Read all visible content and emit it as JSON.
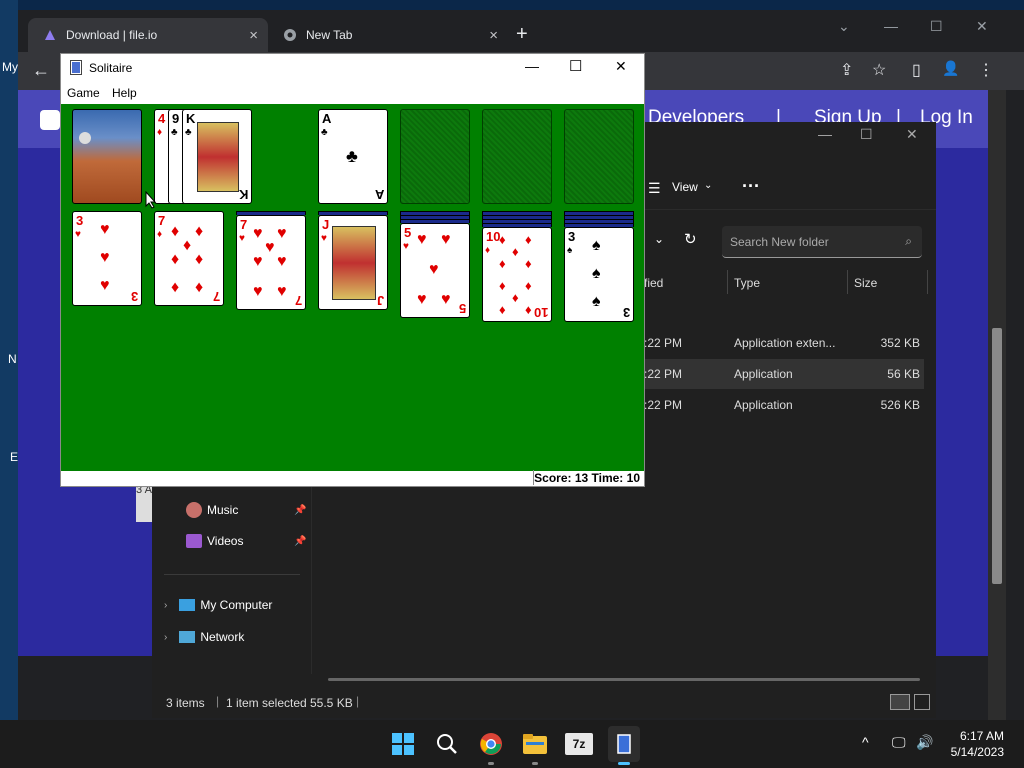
{
  "desktop": {
    "labels": [
      "My",
      "N",
      "E"
    ]
  },
  "browser": {
    "tabs": [
      {
        "title": "Download | file.io",
        "close": "×"
      },
      {
        "title": "New Tab",
        "close": "×"
      }
    ],
    "new_tab": "+",
    "window_controls": {
      "list": "⌄",
      "min": "—",
      "max": "☐",
      "close": "✕"
    },
    "toolbar": {
      "back": "←",
      "share": "⇪",
      "star": "☆",
      "sidebar": "▯",
      "profile": "👤",
      "menu": "⋮"
    },
    "page": {
      "nav": [
        "Developers",
        "|",
        "Sign Up",
        "|",
        "Log In"
      ],
      "left_text": "3 A"
    }
  },
  "explorer": {
    "window_controls": {
      "min": "—",
      "max": "☐",
      "close": "✕"
    },
    "view_label": "View",
    "more": "···",
    "search_placeholder": "Search New folder",
    "columns": [
      "fied",
      "Type",
      "Size"
    ],
    "rows": [
      {
        "date": ":22 PM",
        "type": "Application exten...",
        "size": "352 KB",
        "selected": false
      },
      {
        "date": ":22 PM",
        "type": "Application",
        "size": "56 KB",
        "selected": true
      },
      {
        "date": ":22 PM",
        "type": "Application",
        "size": "526 KB",
        "selected": false
      }
    ],
    "nav": [
      {
        "label": "Music",
        "icon": "music-icon",
        "pinned": true
      },
      {
        "label": "Videos",
        "icon": "videos-icon",
        "pinned": true
      },
      {
        "label": "My Computer",
        "icon": "computer-icon",
        "pinned": false
      },
      {
        "label": "Network",
        "icon": "network-icon",
        "pinned": false
      }
    ],
    "status": {
      "items": "3 items",
      "selected": "1 item selected",
      "size": "55.5 KB"
    }
  },
  "solitaire": {
    "title": "Solitaire",
    "window_controls": {
      "min": "—",
      "max": "☐",
      "close": "✕"
    },
    "menu": [
      "Game",
      "Help"
    ],
    "status": "Score: 13 Time: 10",
    "waste": [
      {
        "rank": "4",
        "suit": "♦",
        "color": "red"
      },
      {
        "rank": "9",
        "suit": "♣",
        "color": "blk"
      },
      {
        "rank": "K",
        "suit": "♣",
        "color": "blk"
      }
    ],
    "foundation": [
      {
        "rank": "A",
        "suit": "♣",
        "color": "blk"
      }
    ],
    "tableau": [
      {
        "rank": "3",
        "suit": "♥",
        "color": "red"
      },
      {
        "rank": "7",
        "suit": "♦",
        "color": "red"
      },
      {
        "rank": "7",
        "suit": "♥",
        "color": "red"
      },
      {
        "rank": "J",
        "suit": "♥",
        "color": "red"
      },
      {
        "rank": "5",
        "suit": "♥",
        "color": "red"
      },
      {
        "rank": "10",
        "suit": "♦",
        "color": "red"
      },
      {
        "rank": "3",
        "suit": "♠",
        "color": "blk"
      }
    ]
  },
  "taskbar": {
    "clock_time": "6:17 AM",
    "clock_date": "5/14/2023",
    "tray": [
      "^",
      "🖵",
      "🔊"
    ]
  }
}
